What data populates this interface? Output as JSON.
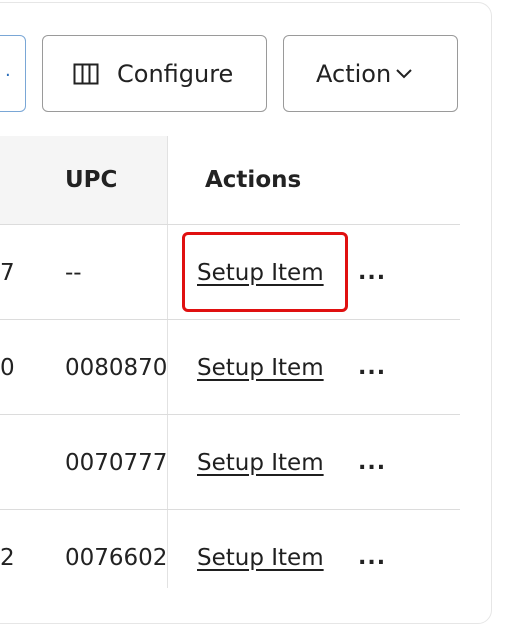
{
  "toolbar": {
    "partial_button_mark": ".",
    "configure_label": "Configure",
    "action_label": "Action"
  },
  "table": {
    "columns": [
      "UPC",
      "Actions"
    ],
    "rows": [
      {
        "first": "7",
        "upc": "--",
        "action": "Setup Item",
        "more": "..."
      },
      {
        "first": "0",
        "upc": "0080870",
        "action": "Setup Item",
        "more": "..."
      },
      {
        "first": "",
        "upc": "0070777",
        "action": "Setup Item",
        "more": "..."
      },
      {
        "first": "2",
        "upc": "0076602",
        "action": "Setup Item",
        "more": "..."
      }
    ]
  },
  "icons": {
    "configure": "columns-icon",
    "action": "chevron-down-icon"
  },
  "colors": {
    "highlight": "#e01010",
    "header_bg": "#f5f5f5",
    "border": "#9a9a9a"
  }
}
